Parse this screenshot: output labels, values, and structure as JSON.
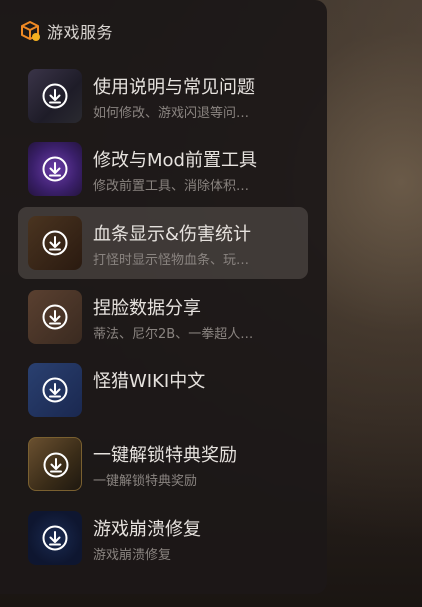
{
  "header": {
    "title": "游戏服务",
    "logo_icon": "game-box-icon",
    "accent": "#f08a24"
  },
  "items": [
    {
      "name": "使用说明与常见问题",
      "desc": "如何修改、游戏闪退等问…",
      "icon": "download-icon"
    },
    {
      "name": "修改与Mod前置工具",
      "desc": "修改前置工具、消除体积…",
      "icon": "download-icon"
    },
    {
      "name": "血条显示&伤害统计",
      "desc": "打怪时显示怪物血条、玩…",
      "icon": "download-icon",
      "active": true
    },
    {
      "name": "捏脸数据分享",
      "desc": "蒂法、尼尔2B、一拳超人…",
      "icon": "download-icon"
    },
    {
      "name": "怪猎WIKI中文",
      "desc": "",
      "icon": "download-icon"
    },
    {
      "name": "一键解锁特典奖励",
      "desc": "一键解锁特典奖励",
      "icon": "download-icon"
    },
    {
      "name": "游戏崩溃修复",
      "desc": "游戏崩溃修复",
      "icon": "download-icon"
    }
  ]
}
